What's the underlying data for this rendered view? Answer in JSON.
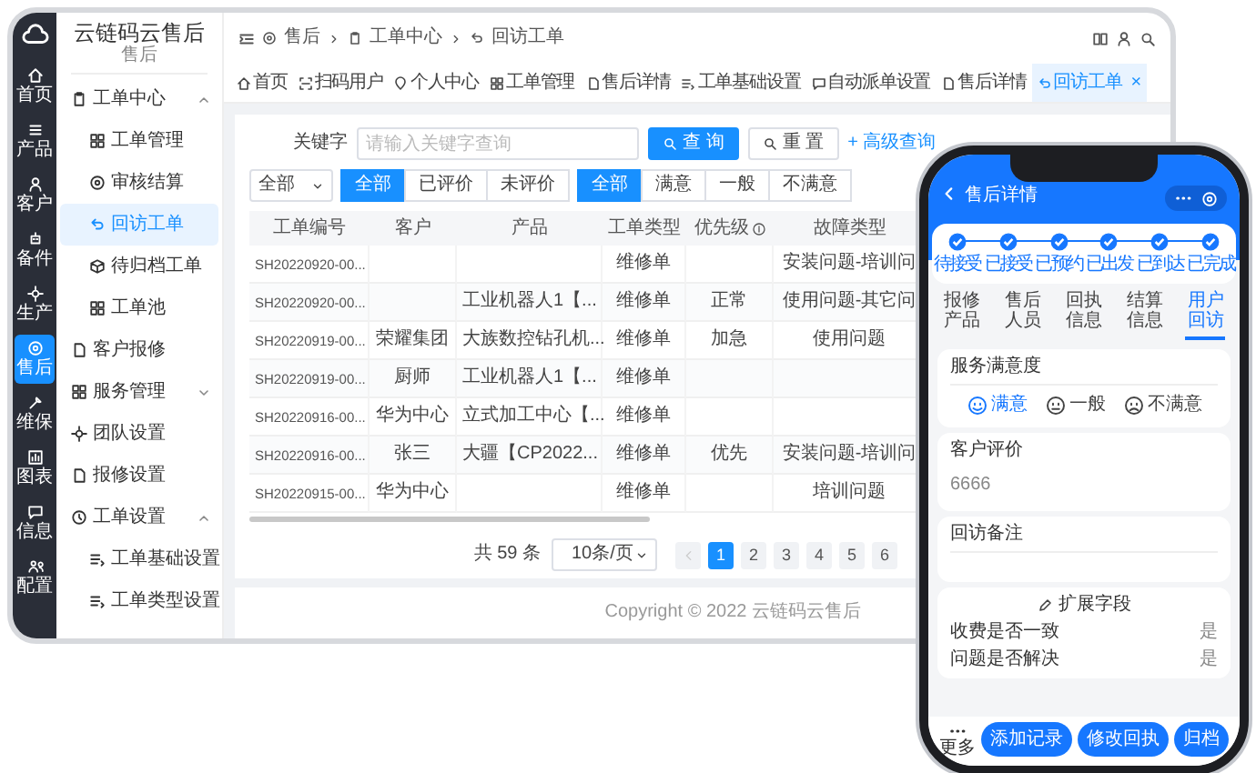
{
  "app": {
    "title": "云链码云售后",
    "subtitle": "售后"
  },
  "rail": [
    {
      "label": "首页",
      "selected": false
    },
    {
      "label": "产品",
      "selected": false
    },
    {
      "label": "客户",
      "selected": false
    },
    {
      "label": "备件",
      "selected": false
    },
    {
      "label": "生产",
      "selected": false
    },
    {
      "label": "售后",
      "selected": true
    },
    {
      "label": "维保",
      "selected": false
    },
    {
      "label": "图表",
      "selected": false
    },
    {
      "label": "信息",
      "selected": false
    },
    {
      "label": "配置",
      "selected": false
    }
  ],
  "menu": [
    {
      "label": "工单中心",
      "kind": "group",
      "expanded": true,
      "selected": false,
      "children": [
        {
          "label": "工单管理",
          "selected": false
        },
        {
          "label": "审核结算",
          "selected": false
        },
        {
          "label": "回访工单",
          "selected": true
        },
        {
          "label": "待归档工单",
          "selected": false
        },
        {
          "label": "工单池",
          "selected": false
        }
      ]
    },
    {
      "label": "客户报修",
      "kind": "item",
      "selected": false
    },
    {
      "label": "服务管理",
      "kind": "group",
      "expanded": false,
      "selected": false
    },
    {
      "label": "团队设置",
      "kind": "item",
      "selected": false
    },
    {
      "label": "报修设置",
      "kind": "item",
      "selected": false
    },
    {
      "label": "工单设置",
      "kind": "group",
      "expanded": true,
      "selected": false,
      "children": [
        {
          "label": "工单基础设置",
          "selected": false
        },
        {
          "label": "工单类型设置",
          "selected": false
        }
      ]
    }
  ],
  "breadcrumb": [
    "售后",
    "工单中心",
    "回访工单"
  ],
  "tabs": [
    {
      "label": "首页",
      "selected": false
    },
    {
      "label": "扫码用户",
      "selected": false
    },
    {
      "label": "个人中心",
      "selected": false
    },
    {
      "label": "工单管理",
      "selected": false
    },
    {
      "label": "售后详情",
      "selected": false
    },
    {
      "label": "工单基础设置",
      "selected": false
    },
    {
      "label": "自动派单设置",
      "selected": false
    },
    {
      "label": "售后详情",
      "selected": false
    },
    {
      "label": "回访工单",
      "selected": true,
      "close": "×"
    }
  ],
  "search": {
    "label": "关键字",
    "placeholder": "请输入关键字查询",
    "search_button": "查 询",
    "reset_button": "重 置",
    "advanced_link": "+ 高级查询"
  },
  "filters": {
    "select": "全部",
    "evaluation": [
      {
        "label": "全部",
        "selected": true
      },
      {
        "label": "已评价",
        "selected": false
      },
      {
        "label": "未评价",
        "selected": false
      }
    ],
    "satisfaction": [
      {
        "label": "全部",
        "selected": true
      },
      {
        "label": "满意",
        "selected": false
      },
      {
        "label": "一般",
        "selected": false
      },
      {
        "label": "不满意",
        "selected": false
      }
    ]
  },
  "table": {
    "columns": [
      {
        "label": "工单编号"
      },
      {
        "label": "客户"
      },
      {
        "label": "产品"
      },
      {
        "label": "工单类型"
      },
      {
        "label": "优先级",
        "info": true
      },
      {
        "label": "故障类型"
      }
    ],
    "rows": [
      [
        "SH20220920-00...",
        null,
        null,
        "维修单",
        null,
        "安装问题-培训问"
      ],
      [
        "SH20220920-00...",
        null,
        "工业机器人1【...",
        "维修单",
        "正常",
        "使用问题-其它问"
      ],
      [
        "SH20220919-00...",
        "荣耀集团",
        "大族数控钻孔机...",
        "维修单",
        "加急",
        "使用问题"
      ],
      [
        "SH20220919-00...",
        "厨师",
        "工业机器人1【...",
        "维修单",
        null,
        null
      ],
      [
        "SH20220916-00...",
        "华为中心",
        "立式加工中心【...",
        "维修单",
        null,
        null
      ],
      [
        "SH20220916-00...",
        "张三",
        "大疆【CP2022...",
        "维修单",
        "优先",
        "安装问题-培训问"
      ],
      [
        "SH20220915-00...",
        "华为中心",
        null,
        "维修单",
        null,
        "培训问题"
      ]
    ]
  },
  "pagination": {
    "total": "共 59 条",
    "page_size": "10条/页",
    "pages": [
      {
        "label": "1",
        "selected": true
      },
      {
        "label": "2",
        "selected": false
      },
      {
        "label": "3",
        "selected": false
      },
      {
        "label": "4",
        "selected": false
      },
      {
        "label": "5",
        "selected": false
      },
      {
        "label": "6",
        "selected": false
      }
    ]
  },
  "footer": "Copyright © 2022 云链码云售后",
  "phone": {
    "title": "售后详情",
    "steps": [
      {
        "label": "待接受",
        "done": true
      },
      {
        "label": "已接受",
        "done": true
      },
      {
        "label": "已预约",
        "done": true
      },
      {
        "label": "已出发",
        "done": true
      },
      {
        "label": "已到达",
        "done": true
      },
      {
        "label": "已完成",
        "done": true
      }
    ],
    "tabs": [
      {
        "label": "报修产品",
        "selected": false
      },
      {
        "label": "售后人员",
        "selected": false
      },
      {
        "label": "回执信息",
        "selected": false
      },
      {
        "label": "结算信息",
        "selected": false
      },
      {
        "label": "用户回访",
        "selected": true
      }
    ],
    "satisfaction": {
      "title": "服务满意度",
      "options": [
        {
          "label": "满意",
          "kind": "happy",
          "selected": true
        },
        {
          "label": "一般",
          "kind": "neutral",
          "selected": false
        },
        {
          "label": "不满意",
          "kind": "sad",
          "selected": false
        }
      ]
    },
    "evaluation": {
      "title": "客户评价",
      "value": "6666"
    },
    "remark": {
      "title": "回访备注"
    },
    "extension": {
      "title": "扩展字段",
      "fields": [
        {
          "label": "收费是否一致",
          "value": "是"
        },
        {
          "label": "问题是否解决",
          "value": "是"
        }
      ]
    },
    "more": "更多",
    "buttons": [
      "添加记录",
      "修改回执",
      "归档"
    ]
  }
}
